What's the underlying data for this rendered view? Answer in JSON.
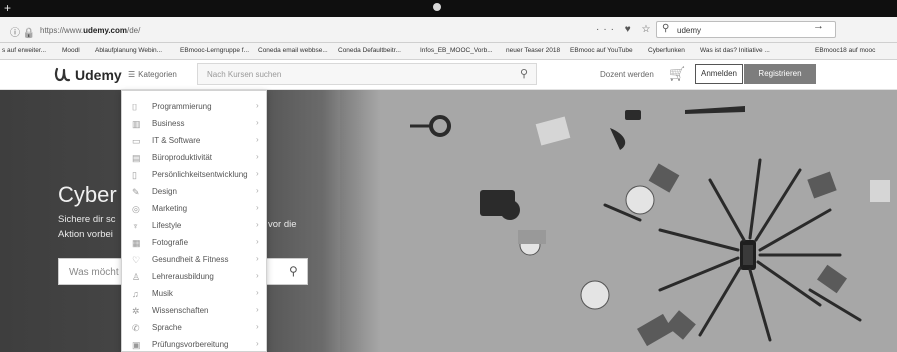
{
  "browser": {
    "new_tab_glyph": "+",
    "url_prefix": "https://www.",
    "url_domain": "udemy.com",
    "url_suffix": "/de/",
    "toolbar_icons": "··· ♥ ☆",
    "search_value": "udemy",
    "go_arrow": "→"
  },
  "bookmarks": [
    "s auf erweiter...",
    "Moodl",
    "Ablaufplanung Webin...",
    "EBmooc-Lerngruppe f...",
    "Coneda email webbse...",
    "Coneda Defaultbeitr...",
    "Infos_EB_MOOC_Vorb...",
    "neuer Teaser 2018",
    "EBmooc auf YouTube",
    "Cyberfunken",
    "Was ist das? Initiative ...",
    "EBmooc18 auf mooc"
  ],
  "header": {
    "logo_text": "Udemy",
    "categories_label": "Kategorien",
    "search_placeholder": "Nach Kursen suchen",
    "instructor_label": "Dozent werden",
    "login_label": "Anmelden",
    "register_label": "Registrieren"
  },
  "hero": {
    "title": "Cyber",
    "line1": "Sichere dir sc",
    "line2": "Aktion vorbei",
    "line3": "vor die",
    "search_placeholder": "Was möcht"
  },
  "categories": [
    {
      "label": "Programmierung",
      "icon": "code-icon"
    },
    {
      "label": "Business",
      "icon": "chart-icon"
    },
    {
      "label": "IT & Software",
      "icon": "monitor-icon"
    },
    {
      "label": "Büroproduktivität",
      "icon": "document-icon"
    },
    {
      "label": "Persönlichkeitsentwicklung",
      "icon": "book-icon"
    },
    {
      "label": "Design",
      "icon": "pencil-icon"
    },
    {
      "label": "Marketing",
      "icon": "target-icon"
    },
    {
      "label": "Lifestyle",
      "icon": "lifestyle-icon"
    },
    {
      "label": "Fotografie",
      "icon": "camera-icon"
    },
    {
      "label": "Gesundheit & Fitness",
      "icon": "heart-icon"
    },
    {
      "label": "Lehrerausbildung",
      "icon": "teacher-icon"
    },
    {
      "label": "Musik",
      "icon": "music-icon"
    },
    {
      "label": "Wissenschaften",
      "icon": "atom-icon"
    },
    {
      "label": "Sprache",
      "icon": "speech-icon"
    },
    {
      "label": "Prüfungsvorbereitung",
      "icon": "exam-icon"
    }
  ],
  "colors": {
    "brand": "#ec5252",
    "hero_dark": "#3e3e3e"
  }
}
